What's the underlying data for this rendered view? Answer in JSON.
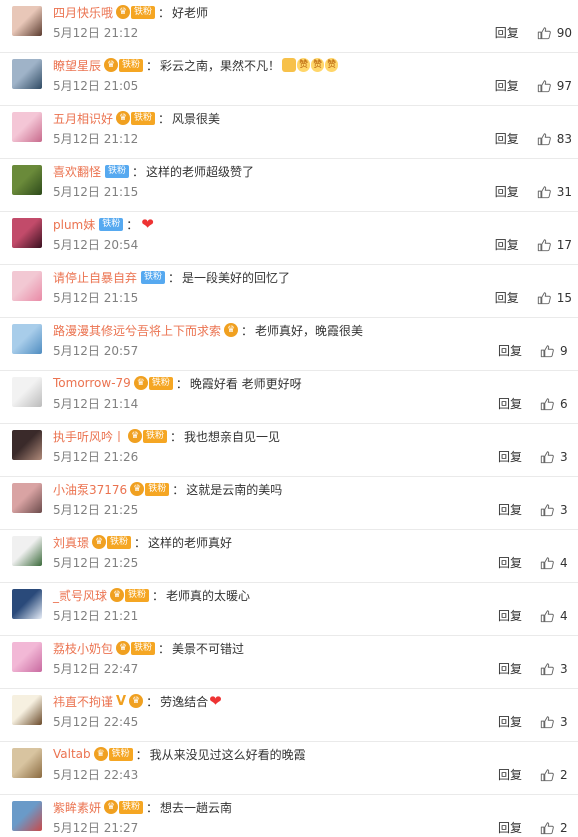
{
  "reply_label": "回复",
  "fan_label": "铁粉",
  "comments": [
    {
      "name": "四月快乐哦",
      "badge": "gold",
      "text": "好老师",
      "time": "5月12日 21:12",
      "likes": "90",
      "av": [
        "#e8c7b8",
        "#5a3b2f"
      ]
    },
    {
      "name": "瞭望星辰",
      "badge": "gold",
      "text": "彩云之南，果然不凡！",
      "emojis": true,
      "time": "5月12日 21:05",
      "likes": "97",
      "av": [
        "#9fb3c8",
        "#2f4a63"
      ]
    },
    {
      "name": "五月相识好",
      "badge": "gold",
      "text": "风景很美",
      "time": "5月12日 21:12",
      "likes": "83",
      "av": [
        "#f4c6d6",
        "#c76a8c"
      ]
    },
    {
      "name": "喜欢翻怪",
      "badge": "blue",
      "text": "这样的老师超级赞了",
      "time": "5月12日 21:15",
      "likes": "31",
      "av": [
        "#6a8a3a",
        "#2d4a1a"
      ]
    },
    {
      "name": "plum妹",
      "badge": "blue",
      "text": "",
      "heart": true,
      "time": "5月12日 20:54",
      "likes": "17",
      "av": [
        "#c24b6a",
        "#3a1020"
      ]
    },
    {
      "name": "请停止自暴自弃",
      "badge": "blue",
      "text": "是一段美好的回忆了",
      "time": "5月12日 21:15",
      "likes": "15",
      "av": [
        "#f2c8d3",
        "#e98aa6"
      ]
    },
    {
      "name": "路漫漫其修远兮吾将上下而求索",
      "badge": "crown",
      "text": "老师真好，晚霞很美",
      "time": "5月12日 20:57",
      "likes": "9",
      "av": [
        "#a8cdea",
        "#4f8cc0"
      ]
    },
    {
      "name": "Tomorrow-79",
      "badge": "gold",
      "text": "晚霞好看 老师更好呀",
      "time": "5月12日 21:14",
      "likes": "6",
      "av": [
        "#f2f2f2",
        "#bbbbbb"
      ]
    },
    {
      "name": "执手听风吟丨",
      "badge": "gold",
      "text": "我也想亲自见一见",
      "time": "5月12日 21:26",
      "likes": "3",
      "av": [
        "#3a2a2a",
        "#b08a7a"
      ]
    },
    {
      "name": "小油泵37176",
      "badge": "gold",
      "text": "这就是云南的美吗",
      "time": "5月12日 21:25",
      "likes": "3",
      "av": [
        "#d9a3a3",
        "#6b4b4b"
      ]
    },
    {
      "name": "刘真璟",
      "badge": "gold",
      "text": "这样的老师真好",
      "time": "5月12日 21:25",
      "likes": "4",
      "av": [
        "#f0f0f0",
        "#3a6a3a"
      ]
    },
    {
      "name": "_贰号风球",
      "badge": "gold",
      "text": "老师真的太暖心",
      "time": "5月12日 21:21",
      "likes": "4",
      "av": [
        "#2a4a7a",
        "#e8eef8"
      ]
    },
    {
      "name": "荔枝小奶包",
      "badge": "gold",
      "text": "美景不可错过",
      "time": "5月12日 22:47",
      "likes": "3",
      "av": [
        "#f2b8d6",
        "#c86aa0"
      ]
    },
    {
      "name": "祎直不拘谨",
      "badge": "v",
      "text": "劳逸结合",
      "heart": true,
      "time": "5月12日 22:45",
      "likes": "3",
      "av": [
        "#f6f0e0",
        "#6a4a2a"
      ]
    },
    {
      "name": "Valtab",
      "badge": "gold",
      "text": "我从来没见过这么好看的晚霞",
      "time": "5月12日 22:43",
      "likes": "2",
      "av": [
        "#d8c4a0",
        "#8a6a40"
      ]
    },
    {
      "name": "紫眸素妍",
      "badge": "gold",
      "text": "想去一趟云南",
      "time": "5月12日 21:27",
      "likes": "2",
      "av": [
        "#6a9ac8",
        "#c84a4a"
      ]
    }
  ]
}
